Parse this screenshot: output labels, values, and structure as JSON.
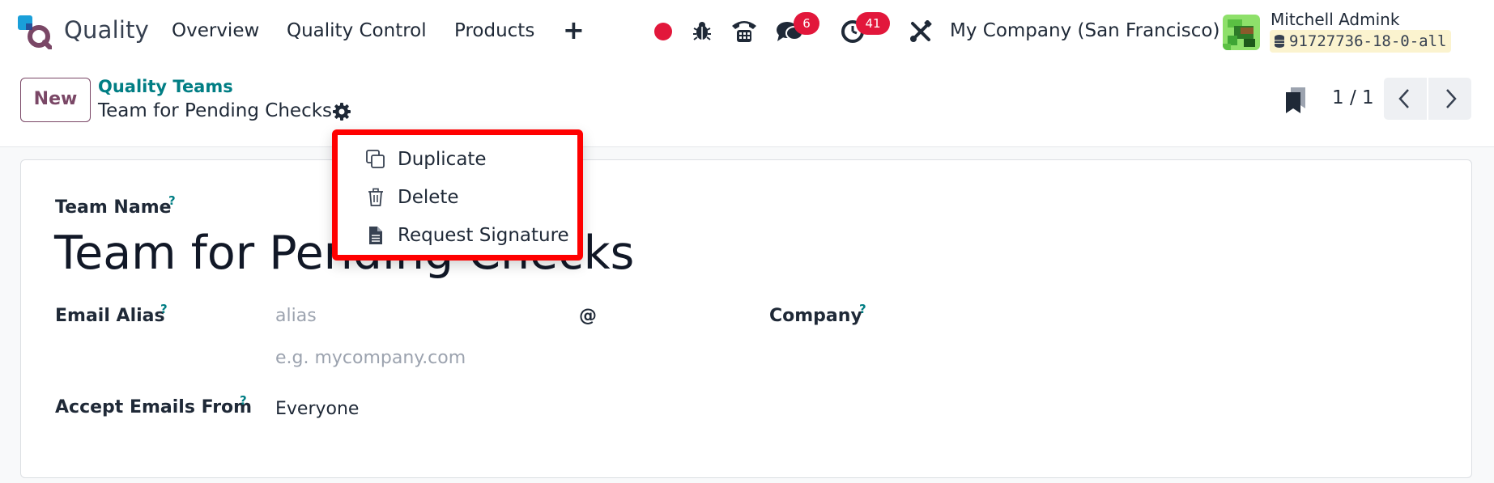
{
  "app": {
    "name": "Quality"
  },
  "nav": {
    "items": [
      {
        "label": "Overview"
      },
      {
        "label": "Quality Control"
      },
      {
        "label": "Products"
      }
    ],
    "plus_label": "+"
  },
  "systray": {
    "chat_count": "6",
    "activity_count": "41",
    "company": "My Company (San Francisco)",
    "user_name": "Mitchell Admink",
    "database": "91727736-18-0-all"
  },
  "control_panel": {
    "new_label": "New",
    "breadcrumb_parent": "Quality Teams",
    "breadcrumb_current": "Team for Pending Checks",
    "pager": "1 / 1"
  },
  "menu": {
    "items": [
      {
        "label": "Duplicate",
        "icon": "copy-icon"
      },
      {
        "label": "Delete",
        "icon": "trash-icon"
      },
      {
        "label": "Request Signature",
        "icon": "document-icon"
      }
    ],
    "highlight_color": "#ff0000"
  },
  "form": {
    "team_name_label": "Team Name",
    "team_name_value": "Team for Pending Checks",
    "email_alias_label": "Email Alias",
    "alias_placeholder": "alias",
    "at_sign": "@",
    "domain_placeholder": "e.g. mycompany.com",
    "company_label": "Company",
    "accept_emails_label": "Accept Emails From",
    "accept_emails_value": "Everyone",
    "help_mark": "?"
  },
  "colors": {
    "accent": "#017e84",
    "brand": "#7a4766",
    "badge": "#e2173b"
  }
}
